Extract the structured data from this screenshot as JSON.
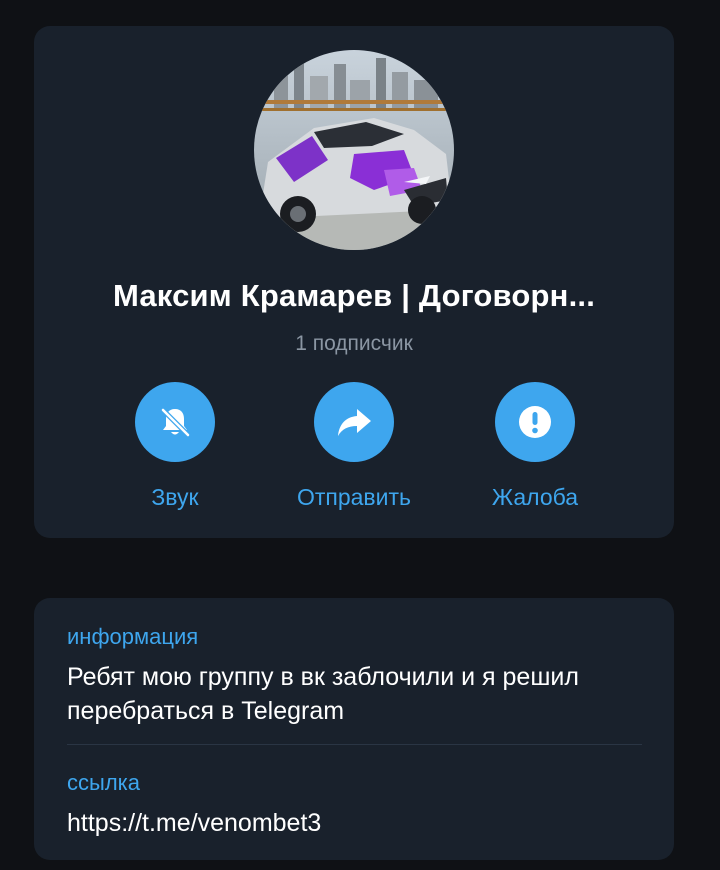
{
  "profile": {
    "title": "Максим Крамарев | Договорн...",
    "subscribers": "1 подписчик"
  },
  "actions": [
    {
      "label": "Звук",
      "icon": "bell-muted-icon"
    },
    {
      "label": "Отправить",
      "icon": "share-arrow-icon"
    },
    {
      "label": "Жалоба",
      "icon": "exclamation-icon"
    }
  ],
  "info": {
    "about_label": "информация",
    "about_text": "Ребят мою группу в вк заблочили и я решил перебраться в Telegram",
    "link_label": "ссылка",
    "link_text": "https://t.me/venombet3"
  },
  "colors": {
    "background": "#0f1115",
    "card": "#19212c",
    "accent": "#3ea6ee",
    "text": "#ffffff",
    "muted": "#8b96a3"
  }
}
